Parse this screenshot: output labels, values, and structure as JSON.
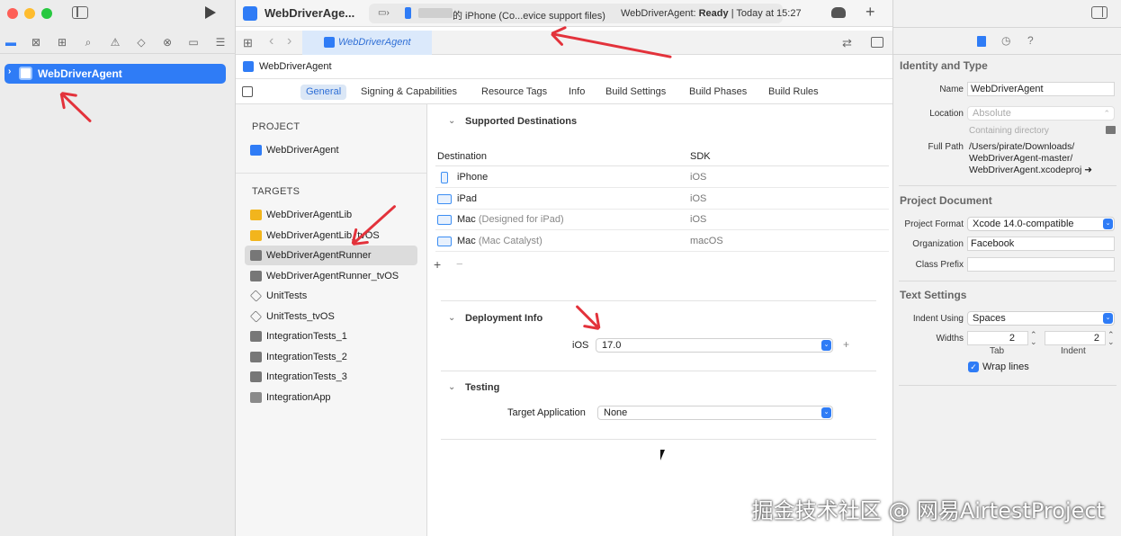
{
  "toolbar": {
    "project_name": "WebDriverAge...",
    "device": "的 iPhone (Co...evice support files)",
    "status_prefix": "WebDriverAgent: ",
    "status_word": "Ready",
    "status_sep": " | Today at 15:27"
  },
  "tabbar": {
    "file_tab": "WebDriverAgent"
  },
  "navigator": {
    "root_item": "WebDriverAgent"
  },
  "breadcrumb": {
    "project": "WebDriverAgent"
  },
  "editor_tabs": [
    {
      "label": "General"
    },
    {
      "label": "Signing & Capabilities"
    },
    {
      "label": "Resource Tags"
    },
    {
      "label": "Info"
    },
    {
      "label": "Build Settings"
    },
    {
      "label": "Build Phases"
    },
    {
      "label": "Build Rules"
    }
  ],
  "target_list": {
    "project_header": "PROJECT",
    "project_item": "WebDriverAgent",
    "targets_header": "TARGETS",
    "targets": [
      {
        "label": "WebDriverAgentLib",
        "icon": "toolbox-icon",
        "color": "#f2b51d"
      },
      {
        "label": "WebDriverAgentLib_tvOS",
        "icon": "toolbox-icon",
        "color": "#f2b51d"
      },
      {
        "label": "WebDriverAgentRunner",
        "icon": "test-runner-icon",
        "color": "#777777"
      },
      {
        "label": "WebDriverAgentRunner_tvOS",
        "icon": "test-runner-icon",
        "color": "#777777"
      },
      {
        "label": "UnitTests",
        "icon": "diamond-icon",
        "color": "#777777"
      },
      {
        "label": "UnitTests_tvOS",
        "icon": "diamond-icon",
        "color": "#777777"
      },
      {
        "label": "IntegrationTests_1",
        "icon": "test-runner-icon",
        "color": "#777777"
      },
      {
        "label": "IntegrationTests_2",
        "icon": "test-runner-icon",
        "color": "#777777"
      },
      {
        "label": "IntegrationTests_3",
        "icon": "test-runner-icon",
        "color": "#777777"
      },
      {
        "label": "IntegrationApp",
        "icon": "app-icon",
        "color": "#8a8a8a"
      }
    ]
  },
  "supported_destinations": {
    "title": "Supported Destinations",
    "col_destination": "Destination",
    "col_sdk": "SDK",
    "rows": [
      {
        "name": "iPhone",
        "detail": "",
        "sdk": "iOS"
      },
      {
        "name": "iPad",
        "detail": "",
        "sdk": "iOS"
      },
      {
        "name": "Mac",
        "detail": " (Designed for iPad)",
        "sdk": "iOS"
      },
      {
        "name": "Mac",
        "detail": " (Mac Catalyst)",
        "sdk": "macOS"
      }
    ],
    "add": "+",
    "remove": "−"
  },
  "deployment_info": {
    "title": "Deployment Info",
    "label": "iOS",
    "value": "17.0",
    "add": "+"
  },
  "testing": {
    "title": "Testing",
    "label": "Target Application",
    "value": "None"
  },
  "inspector": {
    "identity_title": "Identity and Type",
    "name_label": "Name",
    "name_value": "WebDriverAgent",
    "location_label": "Location",
    "location_value": "Absolute",
    "containing": "Containing directory",
    "fullpath_label": "Full Path",
    "fullpath_lines": [
      "/Users/pirate/Downloads/",
      "WebDriverAgent-master/",
      "WebDriverAgent.xcodeproj"
    ],
    "project_doc_title": "Project Document",
    "format_label": "Project Format",
    "format_value": "Xcode 14.0-compatible",
    "org_label": "Organization",
    "org_value": "Facebook",
    "prefix_label": "Class Prefix",
    "prefix_value": "",
    "text_title": "Text Settings",
    "indent_label": "Indent Using",
    "indent_value": "Spaces",
    "widths_label": "Widths",
    "tab_value": "2",
    "indent_width_value": "2",
    "tab_caption": "Tab",
    "indent_caption": "Indent",
    "wrap_label": "Wrap lines"
  },
  "watermark": "掘金技术社区 @ 网易AirtestProject",
  "colors": {
    "accent": "#2f7cf6",
    "annotation": "#e3323b"
  }
}
